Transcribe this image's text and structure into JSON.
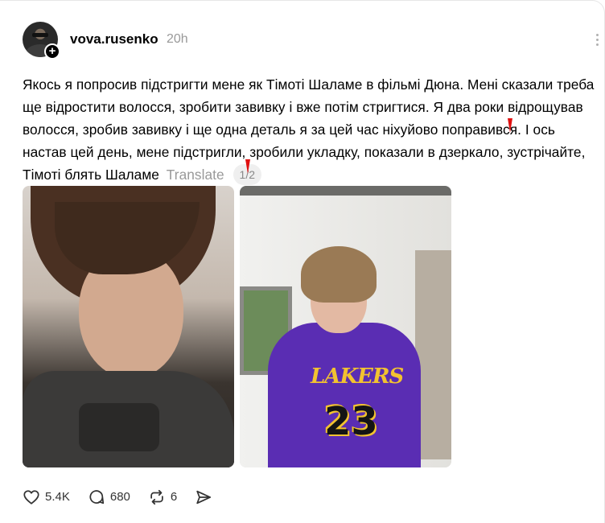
{
  "post": {
    "username": "vova.rusenko",
    "time": "20h",
    "text": "Якось я попросив підстригти мене як Тімоті Шаламе в фільмі Дюна. Мені сказали треба ще відростити волосся, зробити завивку і вже потім стригтися. Я два роки відрощував волосся, зробив завивку і ще одна деталь я за цей час ніхуйово поправився. І ось настав цей день, мене підстригли, зробили укладку, показали в дзеркало, зустрічайте, Тімоті блять Шаламе",
    "translate_label": "Translate",
    "pager": "1/2",
    "photo_right_text": {
      "brand": "LAKERS",
      "number": "23"
    }
  },
  "actions": {
    "likes": "5.4K",
    "replies": "680",
    "reposts": "6"
  },
  "icons": [
    "plus-icon",
    "more-icon",
    "heart-icon",
    "comment-icon",
    "repost-icon",
    "share-icon"
  ],
  "colors": {
    "muted": "#999999",
    "annotation": "#e01010",
    "text": "#000000"
  }
}
